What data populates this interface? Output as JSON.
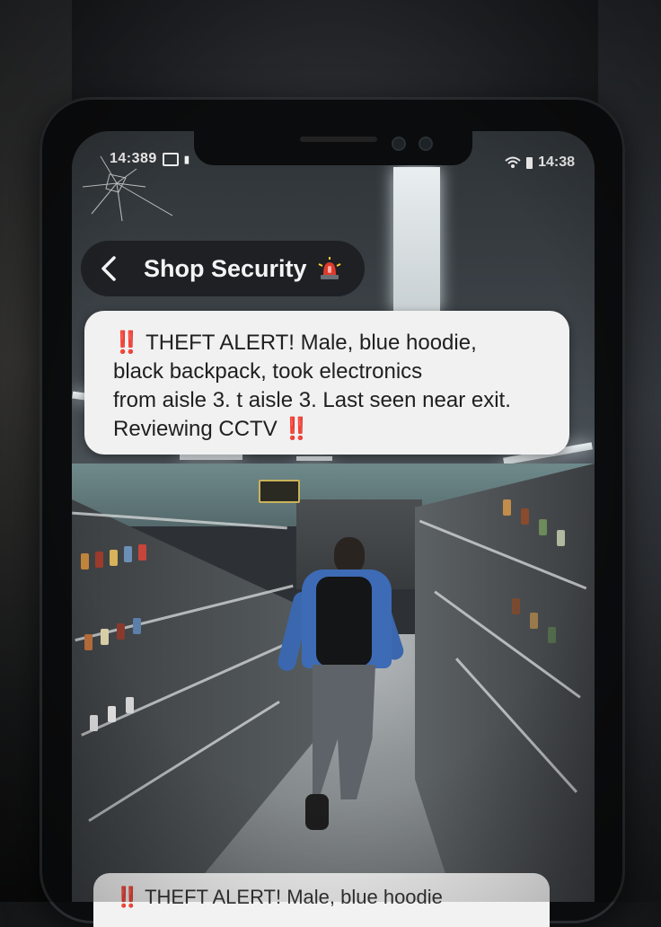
{
  "status_bar": {
    "left_time": "14:389",
    "right_time": "14:38"
  },
  "chat": {
    "title": "Shop Security",
    "back_icon": "chevron-left-icon",
    "title_icon": "siren-icon"
  },
  "message": {
    "prefix": "‼️",
    "text_line1": " THEFT ALERT! Male, blue hoodie,",
    "text_line2": "black backpack, took electronics",
    "text_line3": "from aisle 3. t aisle 3. Last seen near exit.",
    "text_line4": "Reviewing CCTV ",
    "suffix": "‼️"
  },
  "next_message": {
    "text": "‼️ THEFT ALERT! Male, blue hoodie"
  },
  "colors": {
    "hoodie": "#3d6bb5",
    "alert": "#d23a2a",
    "bubble": "#f1f1f1"
  }
}
